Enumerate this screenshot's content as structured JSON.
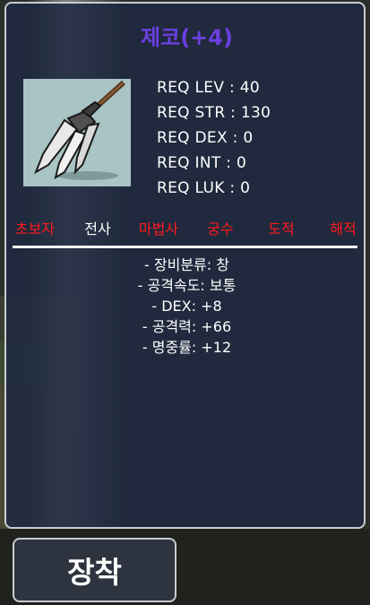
{
  "item": {
    "title": "제코(+4)",
    "icon": "trident-weapon-icon",
    "title_color": "#6b3fe0"
  },
  "requirements": [
    "REQ LEV : 40",
    "REQ STR : 130",
    "REQ DEX : 0",
    "REQ INT : 0",
    "REQ LUK : 0"
  ],
  "jobs": [
    {
      "label": "초보자",
      "color": "#ff1a1a"
    },
    {
      "label": "전사",
      "color": "#ffffff"
    },
    {
      "label": "마법사",
      "color": "#ff1a1a"
    },
    {
      "label": "궁수",
      "color": "#ff1a1a"
    },
    {
      "label": "도적",
      "color": "#ff1a1a"
    },
    {
      "label": "해적",
      "color": "#ff1a1a"
    }
  ],
  "stats": [
    "- 장비분류: 창",
    "- 공격속도: 보통",
    "- DEX: +8",
    "- 공격력: +66",
    "- 명중률: +12"
  ],
  "equip_button": {
    "label": "장착"
  }
}
